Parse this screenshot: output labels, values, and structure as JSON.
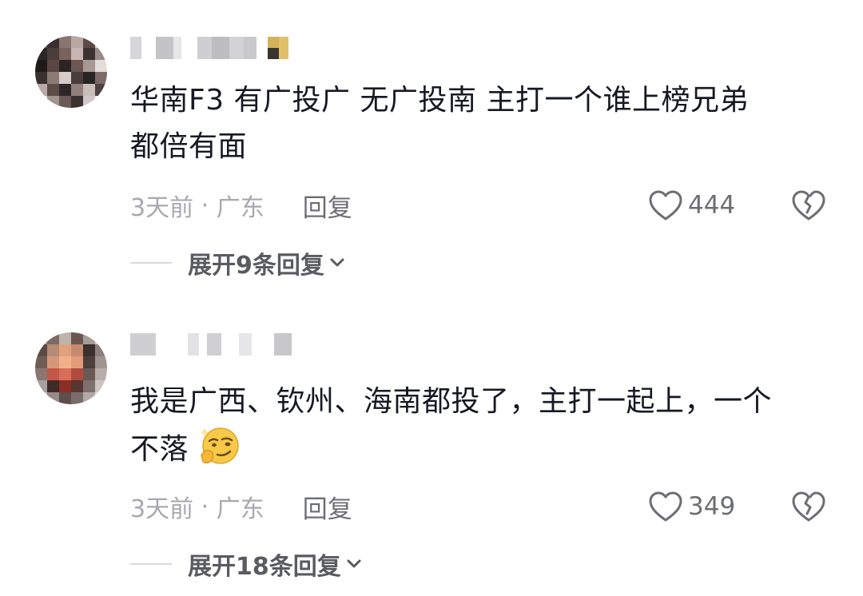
{
  "comments": [
    {
      "text_line1": "华南F3 有广投广 无广投南 主打一个谁上榜兄弟",
      "text_line2": "都倍有面",
      "time": "3天前",
      "location": "广东",
      "reply_label": "回复",
      "likes": "444",
      "expand_label": "展开9条回复"
    },
    {
      "text_line1": "我是广西、钦州、海南都投了，主打一起上，一个",
      "text_line2": "不落",
      "time": "3天前",
      "location": "广东",
      "reply_label": "回复",
      "likes": "349",
      "expand_label": "展开18条回复"
    }
  ],
  "icons": {
    "like": "heart-outline-icon",
    "dislike": "broken-heart-icon",
    "expand": "chevron-down-icon",
    "emoji": "smirk-emoji-icon"
  },
  "colors": {
    "text": "#161823",
    "meta": "#a8a9ad",
    "secondary": "#6d6e73"
  }
}
